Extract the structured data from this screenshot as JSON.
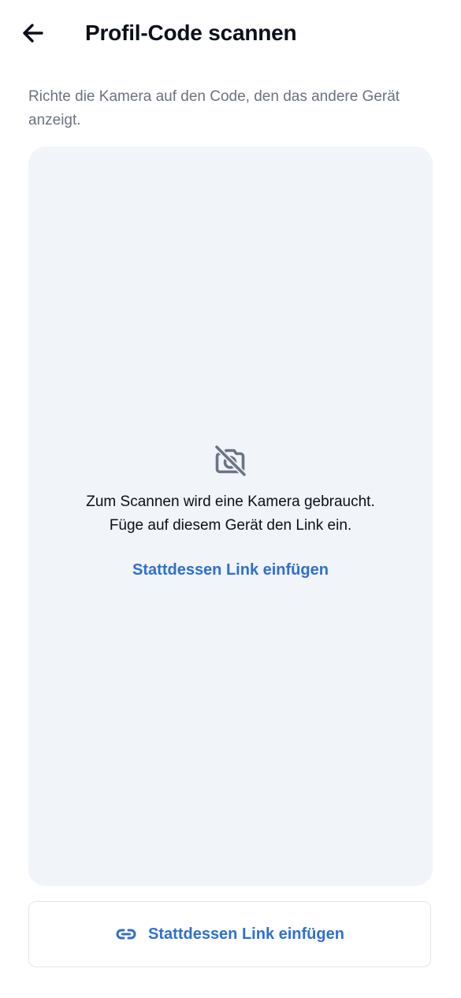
{
  "header": {
    "back_icon": "arrow-left-icon",
    "title": "Profil-Code scannen"
  },
  "instruction": "Richte die Kamera auf den Code, den das andere Gerät anzeigt.",
  "scanner": {
    "icon": "camera-off-icon",
    "message_line1": "Zum Scannen wird eine Kamera gebraucht.",
    "message_line2": "Füge auf diesem Gerät den Link ein.",
    "link_label": "Stattdessen Link einfügen"
  },
  "footer_button": {
    "icon": "link-icon",
    "label": "Stattdessen Link einfügen"
  },
  "colors": {
    "accent": "#2f6fd1",
    "panel_background": "#f1f4f8",
    "muted_text": "#6b7280",
    "icon_gray": "#6b7486"
  }
}
